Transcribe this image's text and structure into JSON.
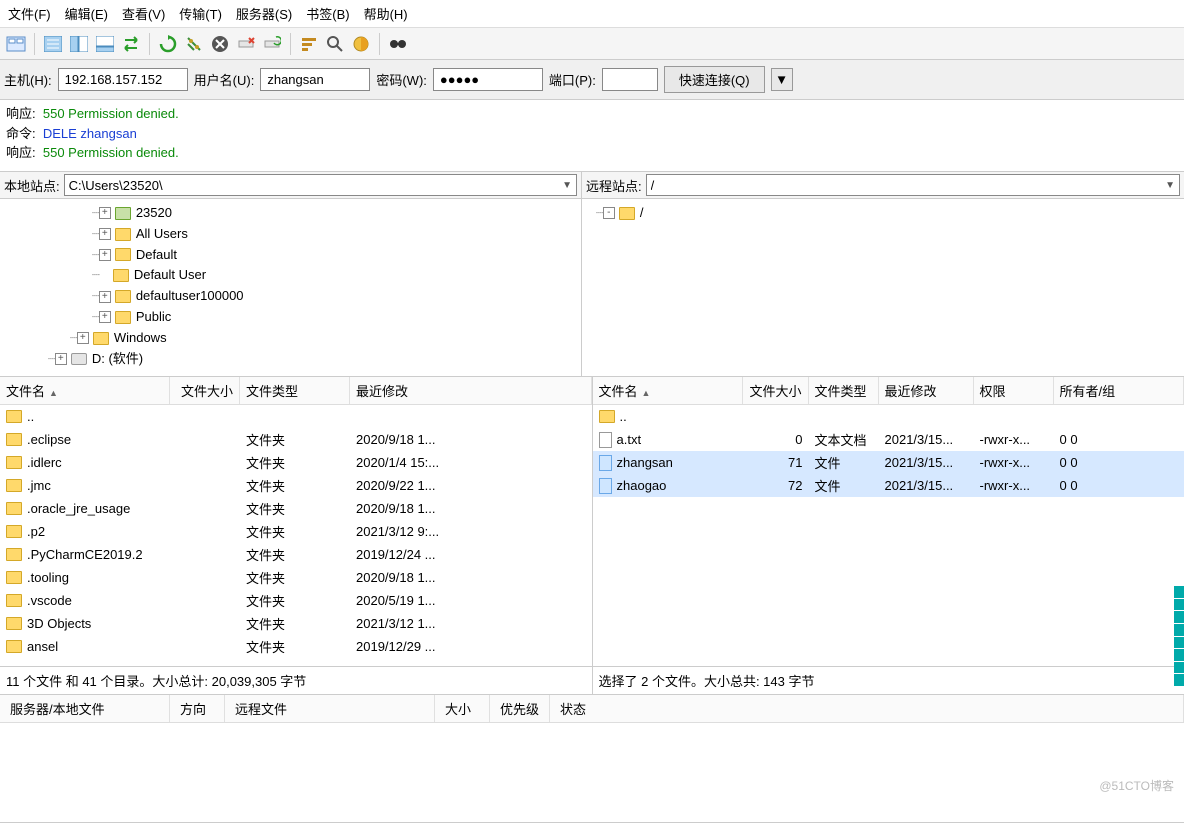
{
  "menu": {
    "file": "文件(F)",
    "edit": "编辑(E)",
    "view": "查看(V)",
    "transfer": "传输(T)",
    "server": "服务器(S)",
    "bookmarks": "书签(B)",
    "help": "帮助(H)"
  },
  "quickbar": {
    "host_label": "主机(H):",
    "host": "192.168.157.152",
    "user_label": "用户名(U):",
    "user": "zhangsan",
    "pass_label": "密码(W):",
    "pass": "●●●●●",
    "port_label": "端口(P):",
    "port": "",
    "connect": "快速连接(Q)",
    "drop": "▼"
  },
  "log": [
    {
      "label": "响应:",
      "text": "550 Permission denied.",
      "cls": "lg-resp"
    },
    {
      "label": "命令:",
      "text": "DELE zhangsan",
      "cls": "lg-cmd"
    },
    {
      "label": "响应:",
      "text": "550 Permission denied.",
      "cls": "lg-resp"
    }
  ],
  "local": {
    "site_label": "本地站点:",
    "path": "C:\\Users\\23520\\",
    "tree": [
      {
        "indent": 90,
        "exp": "+",
        "icon": "fldr-user",
        "name": "23520"
      },
      {
        "indent": 90,
        "exp": "+",
        "icon": "fldr",
        "name": "All Users"
      },
      {
        "indent": 90,
        "exp": "+",
        "icon": "fldr",
        "name": "Default"
      },
      {
        "indent": 90,
        "exp": "",
        "icon": "fldr",
        "name": "Default User"
      },
      {
        "indent": 90,
        "exp": "+",
        "icon": "fldr",
        "name": "defaultuser100000"
      },
      {
        "indent": 90,
        "exp": "+",
        "icon": "fldr",
        "name": "Public"
      },
      {
        "indent": 68,
        "exp": "+",
        "icon": "fldr",
        "name": "Windows"
      },
      {
        "indent": 46,
        "exp": "+",
        "icon": "drive",
        "name": "D: (软件)"
      }
    ],
    "headers": {
      "name": "文件名",
      "size": "文件大小",
      "type": "文件类型",
      "modified": "最近修改"
    },
    "rows": [
      {
        "name": "..",
        "type": "",
        "modified": "",
        "icon": "fldr"
      },
      {
        "name": ".eclipse",
        "type": "文件夹",
        "modified": "2020/9/18 1...",
        "icon": "fldr"
      },
      {
        "name": ".idlerc",
        "type": "文件夹",
        "modified": "2020/1/4 15:...",
        "icon": "fldr"
      },
      {
        "name": ".jmc",
        "type": "文件夹",
        "modified": "2020/9/22 1...",
        "icon": "fldr"
      },
      {
        "name": ".oracle_jre_usage",
        "type": "文件夹",
        "modified": "2020/9/18 1...",
        "icon": "fldr"
      },
      {
        "name": ".p2",
        "type": "文件夹",
        "modified": "2021/3/12 9:...",
        "icon": "fldr"
      },
      {
        "name": ".PyCharmCE2019.2",
        "type": "文件夹",
        "modified": "2019/12/24 ...",
        "icon": "fldr"
      },
      {
        "name": ".tooling",
        "type": "文件夹",
        "modified": "2020/9/18 1...",
        "icon": "fldr"
      },
      {
        "name": ".vscode",
        "type": "文件夹",
        "modified": "2020/5/19 1...",
        "icon": "fldr"
      },
      {
        "name": "3D Objects",
        "type": "文件夹",
        "modified": "2021/3/12 1...",
        "icon": "fldr"
      },
      {
        "name": "ansel",
        "type": "文件夹",
        "modified": "2019/12/29 ...",
        "icon": "fldr"
      }
    ],
    "status": "11 个文件 和 41 个目录。大小总计: 20,039,305 字节"
  },
  "remote": {
    "site_label": "远程站点:",
    "path": "/",
    "tree": [
      {
        "indent": 12,
        "exp": "-",
        "icon": "fldr",
        "name": "/"
      }
    ],
    "headers": {
      "name": "文件名",
      "size": "文件大小",
      "type": "文件类型",
      "modified": "最近修改",
      "perm": "权限",
      "owner": "所有者/组"
    },
    "rows": [
      {
        "name": "..",
        "size": "",
        "type": "",
        "modified": "",
        "perm": "",
        "owner": "",
        "icon": "fldr",
        "sel": false
      },
      {
        "name": "a.txt",
        "size": "0",
        "type": "文本文档",
        "modified": "2021/3/15...",
        "perm": "-rwxr-x...",
        "owner": "0 0",
        "icon": "file",
        "sel": false
      },
      {
        "name": "zhangsan",
        "size": "71",
        "type": "文件",
        "modified": "2021/3/15...",
        "perm": "-rwxr-x...",
        "owner": "0 0",
        "icon": "file",
        "sel": true
      },
      {
        "name": "zhaogao",
        "size": "72",
        "type": "文件",
        "modified": "2021/3/15...",
        "perm": "-rwxr-x...",
        "owner": "0 0",
        "icon": "file",
        "sel": true
      }
    ],
    "status": "选择了 2 个文件。大小总共: 143 字节"
  },
  "queue": {
    "server": "服务器/本地文件",
    "dir": "方向",
    "remote": "远程文件",
    "size": "大小",
    "priority": "优先级",
    "status": "状态"
  },
  "watermark": "@51CTO博客"
}
